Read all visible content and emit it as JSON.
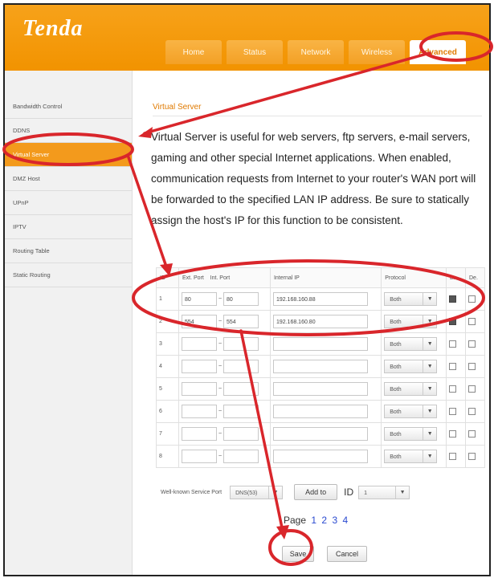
{
  "header": {
    "logo": "Tenda"
  },
  "nav": {
    "tabs": [
      "Home",
      "Status",
      "Network",
      "Wireless",
      "Advanced"
    ],
    "active_index": 4
  },
  "sidebar": {
    "items": [
      "Bandwidth Control",
      "DDNS",
      "Virtual Server",
      "DMZ Host",
      "UPnP",
      "IPTV",
      "Routing Table",
      "Static Routing"
    ],
    "active_index": 2
  },
  "main": {
    "section_title": "Virtual Server",
    "description": "Virtual Server is useful for web servers, ftp servers, e-mail servers, gaming and other special Internet applications. When enabled, communication requests from Internet to your router's WAN port will be forwarded to the specified LAN IP address. Be sure to statically assign the host's IP for this function to be consistent."
  },
  "table": {
    "headers": [
      "ID",
      "Ext. Port",
      "Int. Port",
      "Internal IP",
      "Protocol",
      "En.",
      "De."
    ],
    "rows": [
      {
        "id": "1",
        "ext_port": "80",
        "sep": "~",
        "int_port": "80",
        "ip": "192.168.160.88",
        "protocol": "Both",
        "enabled": true,
        "delete": false
      },
      {
        "id": "2",
        "ext_port": "554",
        "sep": "~",
        "int_port": "554",
        "ip": "192.168.160.80",
        "protocol": "Both",
        "enabled": true,
        "delete": false
      },
      {
        "id": "3",
        "ext_port": "",
        "sep": "~",
        "int_port": "",
        "ip": "",
        "protocol": "Both",
        "enabled": false,
        "delete": false
      },
      {
        "id": "4",
        "ext_port": "",
        "sep": "~",
        "int_port": "",
        "ip": "",
        "protocol": "Both",
        "enabled": false,
        "delete": false
      },
      {
        "id": "5",
        "ext_port": "",
        "sep": "~",
        "int_port": "",
        "ip": "",
        "protocol": "Both",
        "enabled": false,
        "delete": false
      },
      {
        "id": "6",
        "ext_port": "",
        "sep": "~",
        "int_port": "",
        "ip": "",
        "protocol": "Both",
        "enabled": false,
        "delete": false
      },
      {
        "id": "7",
        "ext_port": "",
        "sep": "~",
        "int_port": "",
        "ip": "",
        "protocol": "Both",
        "enabled": false,
        "delete": false
      },
      {
        "id": "8",
        "ext_port": "",
        "sep": "~",
        "int_port": "",
        "ip": "",
        "protocol": "Both",
        "enabled": false,
        "delete": false
      }
    ]
  },
  "wellknown": {
    "label": "Well-known Service Port",
    "selected": "DNS(53)",
    "add_label": "Add to",
    "id_label": "ID",
    "id_selected": "1"
  },
  "pager": {
    "label": "Page",
    "pages": [
      "1",
      "2",
      "3",
      "4"
    ]
  },
  "actions": {
    "save": "Save",
    "cancel": "Cancel"
  },
  "icons": {
    "dropdown": "chevron-down-icon"
  },
  "colors": {
    "brand_orange": "#f39a1c",
    "annotation_red": "#d9262b",
    "link_blue": "#2a4ad0"
  }
}
